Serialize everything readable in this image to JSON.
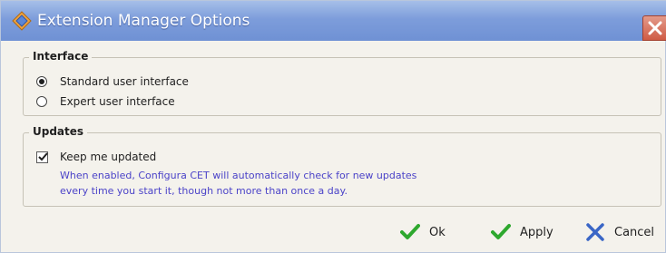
{
  "window": {
    "title": "Extension Manager Options"
  },
  "interface_group": {
    "legend": "Interface",
    "options": [
      {
        "label": "Standard user interface",
        "selected": true
      },
      {
        "label": "Expert user interface",
        "selected": false
      }
    ]
  },
  "updates_group": {
    "legend": "Updates",
    "keep_updated": {
      "label": "Keep me updated",
      "checked": true
    },
    "description_lines": [
      "When enabled, Configura CET will automatically check for new updates",
      "every time you start it, though not more than once a day."
    ]
  },
  "buttons": {
    "ok": "Ok",
    "apply": "Apply",
    "cancel": "Cancel"
  },
  "icons": {
    "app": "extension-manager-icon",
    "close": "close-icon",
    "ok": "green-check-icon",
    "apply": "green-check-icon",
    "cancel": "blue-x-icon"
  },
  "colors": {
    "titlebar": "#7d9ddb",
    "description_text": "#4b43c8",
    "check_green": "#2ea82e",
    "cancel_blue": "#3a66c6",
    "close_red": "#cf5b45"
  }
}
